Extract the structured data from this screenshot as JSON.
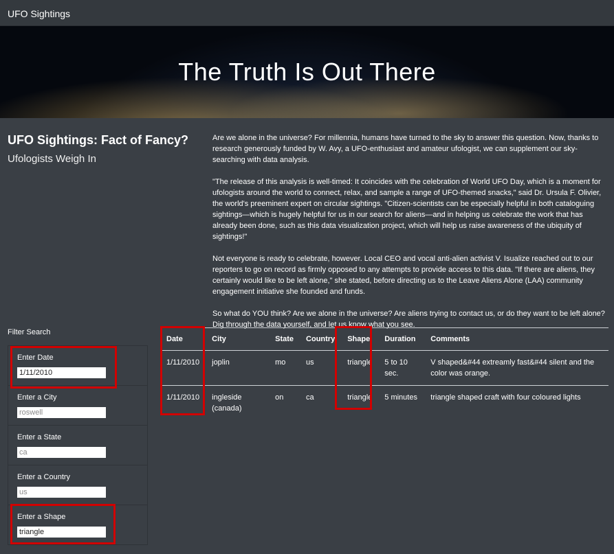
{
  "navbar": {
    "brand": "UFO Sightings"
  },
  "hero": {
    "title": "The Truth Is Out There"
  },
  "intro": {
    "title": "UFO Sightings: Fact of Fancy?",
    "subtitle": "Ufologists Weigh In"
  },
  "article": {
    "paragraphs": [
      "Are we alone in the universe? For millennia, humans have turned to the sky to answer this question. Now, thanks to research generously funded by W. Avy, a UFO-enthusiast and amateur ufologist, we can supplement our sky-searching with data analysis.",
      "\"The release of this analysis is well-timed: It coincides with the celebration of World UFO Day, which is a moment for ufologists around the world to connect, relax, and sample a range of UFO-themed snacks,\" said Dr. Ursula F. Olivier, the world's preeminent expert on circular sightings. \"Citizen-scientists can be especially helpful in both cataloguing sightings—which is hugely helpful for us in our search for aliens—and in helping us celebrate the work that has already been done, such as this data visualization project, which will help us raise awareness of the ubiquity of sightings!\"",
      "Not everyone is ready to celebrate, however. Local CEO and vocal anti-alien activist V. Isualize reached out to our reporters to go on record as firmly opposed to any attempts to provide access to this data. \"If there are aliens, they certainly would like to be left alone,\" she stated, before directing us to the Leave Aliens Alone (LAA) community engagement initiative she founded and funds.",
      "So what do YOU think? Are we alone in the universe? Are aliens trying to contact us, or do they want to be left alone? Dig through the data yourself, and let us know what you see."
    ]
  },
  "filters": {
    "title": "Filter Search",
    "date": {
      "label": "Enter Date",
      "value": "1/11/2010",
      "placeholder": ""
    },
    "city": {
      "label": "Enter a City",
      "value": "",
      "placeholder": "roswell"
    },
    "state": {
      "label": "Enter a State",
      "value": "",
      "placeholder": "ca"
    },
    "country": {
      "label": "Enter a Country",
      "value": "",
      "placeholder": "us"
    },
    "shape": {
      "label": "Enter a Shape",
      "value": "triangle",
      "placeholder": ""
    }
  },
  "table": {
    "headers": [
      "Date",
      "City",
      "State",
      "Country",
      "Shape",
      "Duration",
      "Comments"
    ],
    "rows": [
      [
        "1/11/2010",
        "joplin",
        "mo",
        "us",
        "triangle",
        "5 to 10 sec.",
        "V shaped&#44 extreamly fast&#44 silent and the color was orange."
      ],
      [
        "1/11/2010",
        "ingleside (canada)",
        "on",
        "ca",
        "triangle",
        "5 minutes",
        "triangle shaped craft with four coloured lights"
      ]
    ]
  },
  "colors": {
    "highlight": "#d20000",
    "background": "#3a3f45"
  }
}
